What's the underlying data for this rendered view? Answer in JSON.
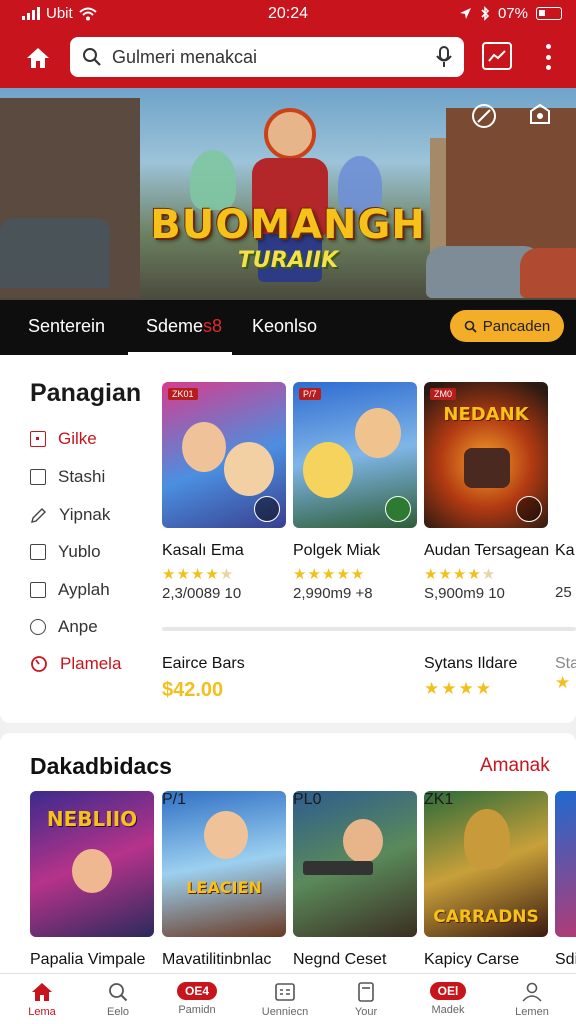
{
  "status_bar": {
    "carrier": "Ubit",
    "time": "20:24",
    "battery": "07%"
  },
  "header": {
    "search_placeholder": "Gulmeri menakcai"
  },
  "hero": {
    "title": "BUOMANGH",
    "subtitle": "TURAIIK"
  },
  "tabs": [
    {
      "label": "Senterein"
    },
    {
      "label_main": "Sdeme",
      "label_red": "s8"
    },
    {
      "label": "Keonlso"
    }
  ],
  "cta_label": "Pancaden",
  "section1": {
    "title": "Panagian",
    "categories": [
      {
        "label": "Gilke"
      },
      {
        "label": "Stashi"
      },
      {
        "label": "Yipnak"
      },
      {
        "label": "Yublo"
      },
      {
        "label": "Ayplah"
      },
      {
        "label": "Anpe"
      },
      {
        "label": "Plamela"
      }
    ],
    "games": [
      {
        "title": "Kasalı Ema",
        "meta": "2,3/0089 10",
        "tag": "ZK01",
        "rating": 4
      },
      {
        "title": "Polgek Miak",
        "meta": "2,990m9 +8",
        "tag": "P/7",
        "rating": 5
      },
      {
        "title": "Audan Tersagean",
        "meta": "S,900m9 10",
        "tag": "ZM0",
        "rating": 4,
        "art": "NEDANK"
      },
      {
        "title": "Ka",
        "meta": "25",
        "tag": "",
        "rating": 0
      }
    ],
    "secondary": [
      {
        "title": "Eairce Bars",
        "price": "$42.00"
      },
      {
        "title": "Sytans Ildare"
      },
      {
        "title": "Sta"
      }
    ]
  },
  "section2": {
    "title": "Dakadbidacs",
    "link": "Amanak",
    "games": [
      {
        "title": "Papalia Vimpale",
        "art": "NEBLIIO",
        "tag": ""
      },
      {
        "title": "Mavatilitinbnlac",
        "art": "LEACIEN",
        "tag": "P/1"
      },
      {
        "title": "Negnd Ceset",
        "art": "",
        "tag": "PL0"
      },
      {
        "title": "Kapicy Carse",
        "art": "CARRADNS",
        "tag": "ZK1"
      },
      {
        "title": "Sdi",
        "art": "",
        "tag": ""
      }
    ]
  },
  "bottom_nav": [
    {
      "label": "Lema",
      "icon": "home-icon"
    },
    {
      "label": "Eelo",
      "icon": "search-icon"
    },
    {
      "label": "Pamidn",
      "pill": "OE4"
    },
    {
      "label": "Uenniecn",
      "icon": "calendar-icon"
    },
    {
      "label": "Your",
      "icon": "document-icon"
    },
    {
      "label": "Madek",
      "pill": "OEl"
    },
    {
      "label": "Lemen",
      "icon": "user-icon"
    }
  ],
  "colors": {
    "brand_red": "#c8141c",
    "accent_gold": "#f4ad27",
    "star": "#f2c01d"
  }
}
